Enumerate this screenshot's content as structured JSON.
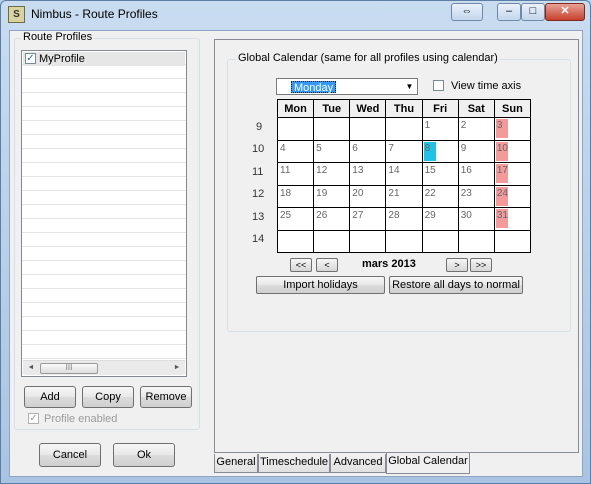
{
  "window": {
    "title": "Nimbus - Route Profiles",
    "icon": "app-icon",
    "icon_glyph": "S"
  },
  "titlebar_buttons": {
    "restore_glyph": "⇔",
    "minimize_glyph": "–",
    "maximize_glyph": "□",
    "close_glyph": "✕"
  },
  "profiles_group": {
    "label": "Route Profiles",
    "items": [
      {
        "label": "MyProfile",
        "checked": true
      }
    ],
    "scroll_thumb_glyph": "III",
    "scroll_left": "◄",
    "scroll_right": "►"
  },
  "profile_buttons": {
    "add": "Add",
    "copy": "Copy",
    "remove": "Remove"
  },
  "profile_enabled": {
    "label": "Profile enabled",
    "checked": true,
    "disabled": true
  },
  "dialog_buttons": {
    "cancel": "Cancel",
    "ok": "Ok"
  },
  "tabs": [
    {
      "label": "General",
      "active": false
    },
    {
      "label": "Timeschedule",
      "active": false
    },
    {
      "label": "Advanced",
      "active": false
    },
    {
      "label": "Global Calendar",
      "active": true
    }
  ],
  "global_calendar": {
    "group_label": "Global Calendar (same for all profiles using calendar)",
    "first_day_select": {
      "value": "Monday"
    },
    "view_time_axis": {
      "label": "View time axis",
      "checked": false
    },
    "weekday_headers": [
      "Mon",
      "Tue",
      "Wed",
      "Thu",
      "Fri",
      "Sat",
      "Sun"
    ],
    "week_numbers": [
      "9",
      "10",
      "11",
      "12",
      "13",
      "14"
    ],
    "weeks": [
      [
        "",
        "",
        "",
        "",
        "1",
        "2",
        "3"
      ],
      [
        "4",
        "5",
        "6",
        "7",
        "8",
        "9",
        "10"
      ],
      [
        "11",
        "12",
        "13",
        "14",
        "15",
        "16",
        "17"
      ],
      [
        "18",
        "19",
        "20",
        "21",
        "22",
        "23",
        "24"
      ],
      [
        "25",
        "26",
        "27",
        "28",
        "29",
        "30",
        "31"
      ],
      [
        "",
        "",
        "",
        "",
        "",
        "",
        ""
      ]
    ],
    "holiday_color": "#f59a9a",
    "today_color": "#1ec3e6",
    "today_day": "8",
    "holiday_days": [
      "3",
      "10",
      "17",
      "24",
      "31"
    ],
    "month_label": "mars 2013",
    "nav": {
      "prev_year": "<<",
      "prev_month": "<",
      "next_month": ">",
      "next_year": ">>"
    },
    "import_button": "Import holidays",
    "restore_button": "Restore all days to normal"
  }
}
